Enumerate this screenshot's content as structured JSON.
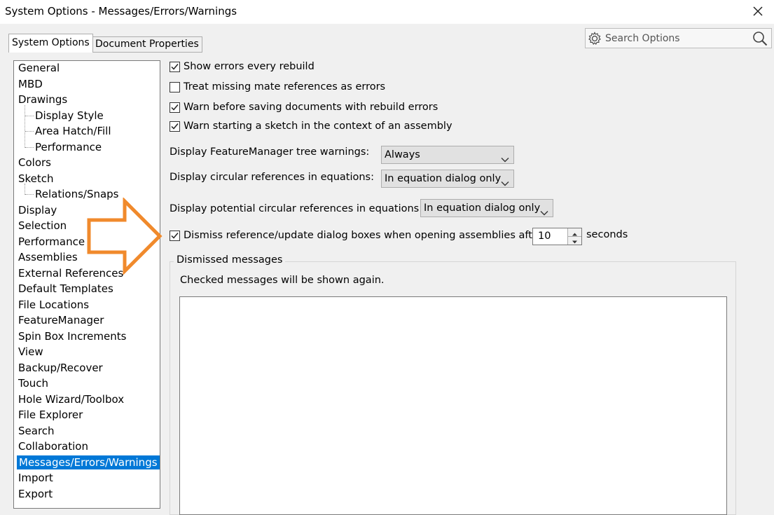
{
  "window": {
    "title": "System Options - Messages/Errors/Warnings"
  },
  "tabs": [
    {
      "label": "System Options",
      "active": true
    },
    {
      "label": "Document Properties",
      "active": false
    }
  ],
  "search": {
    "placeholder": "Search Options"
  },
  "tree": {
    "items": [
      {
        "label": "General"
      },
      {
        "label": "MBD"
      },
      {
        "label": "Drawings"
      },
      {
        "label": "Display Style"
      },
      {
        "label": "Area Hatch/Fill"
      },
      {
        "label": "Performance"
      },
      {
        "label": "Colors"
      },
      {
        "label": "Sketch"
      },
      {
        "label": "Relations/Snaps"
      },
      {
        "label": "Display"
      },
      {
        "label": "Selection"
      },
      {
        "label": "Performance"
      },
      {
        "label": "Assemblies"
      },
      {
        "label": "External References"
      },
      {
        "label": "Default Templates"
      },
      {
        "label": "File Locations"
      },
      {
        "label": "FeatureManager"
      },
      {
        "label": "Spin Box Increments"
      },
      {
        "label": "View"
      },
      {
        "label": "Backup/Recover"
      },
      {
        "label": "Touch"
      },
      {
        "label": "Hole Wizard/Toolbox"
      },
      {
        "label": "File Explorer"
      },
      {
        "label": "Search"
      },
      {
        "label": "Collaboration"
      },
      {
        "label": "Messages/Errors/Warnings",
        "selected": true
      },
      {
        "label": "Import"
      },
      {
        "label": "Export"
      }
    ]
  },
  "options": {
    "checkboxes": [
      {
        "label": "Show errors every rebuild",
        "checked": true
      },
      {
        "label": "Treat missing mate references as errors",
        "checked": false
      },
      {
        "label": "Warn before saving documents with rebuild errors",
        "checked": true
      },
      {
        "label": "Warn starting a sketch in the context of an assembly",
        "checked": true
      }
    ],
    "featuremanager_warnings": {
      "label": "Display FeatureManager tree warnings:",
      "value": "Always"
    },
    "circular_refs": {
      "label": "Display circular references in equations:",
      "value": "In equation dialog only"
    },
    "potential_circular_refs": {
      "label": "Display potential circular references in equations:",
      "value": "In equation dialog only"
    },
    "dismiss": {
      "label": "Dismiss reference/update dialog boxes when opening assemblies after:",
      "checked": true,
      "value": "10",
      "unit": "seconds"
    }
  },
  "dismissed": {
    "group_label": "Dismissed messages",
    "hint": "Checked messages will be shown again."
  },
  "colors": {
    "selection": "#0078d7",
    "arrow": "#f08a2c"
  }
}
